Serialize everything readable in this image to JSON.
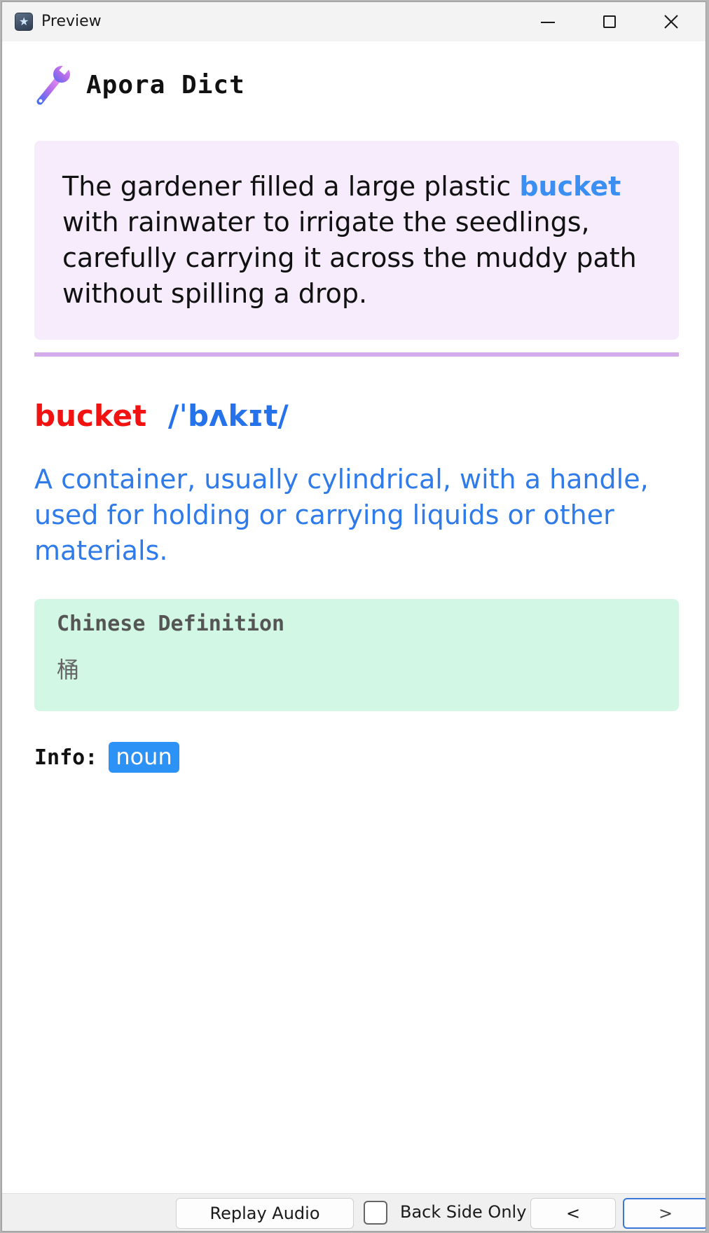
{
  "window": {
    "title": "Preview"
  },
  "brand": {
    "name": "Apora Dict"
  },
  "example": {
    "before": "The gardener filled a large plastic ",
    "highlight": "bucket",
    "after": " with rainwater to irrigate the seedlings, carefully carrying it across the muddy path without spilling a drop."
  },
  "entry": {
    "word": "bucket",
    "phonetic": "/ˈbʌkɪt/",
    "definition": "A container, usually cylindrical, with a handle, used for holding or carrying liquids or other materials."
  },
  "chinese": {
    "title": "Chinese Definition",
    "value": "桶"
  },
  "info": {
    "label": "Info:",
    "part_of_speech": "noun"
  },
  "controls": {
    "replay_label": "Replay Audio",
    "back_side_label": "Back Side Only",
    "back_side_checked": false,
    "prev_label": "<",
    "next_label": ">"
  },
  "colors": {
    "highlight": "#3b8ff3",
    "headword": "#f21212",
    "phonetic": "#2672ea",
    "definition": "#2f7bea",
    "sentence_bg": "#f6ecfc",
    "divider": "#d4acec",
    "chinese_bg": "#d2f7e4",
    "badge_bg": "#2c92f6"
  }
}
